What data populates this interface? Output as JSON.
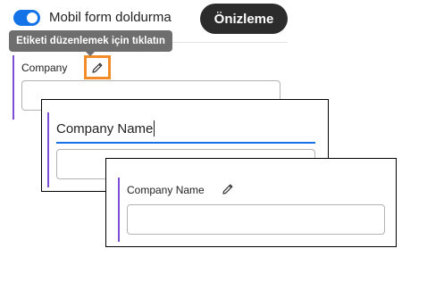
{
  "toolbar": {
    "mobile_form_fill_label": "Mobil form doldurma",
    "mobile_form_fill_enabled": true,
    "preview_label": "Önizleme"
  },
  "tooltip": {
    "text": "Etiketi düzenlemek için tıklatın"
  },
  "field": {
    "label": "Company",
    "edit_icon": "pencil-icon"
  },
  "zoom_editing": {
    "label_value": "Company Name"
  },
  "zoom_result": {
    "label": "Company Name",
    "edit_icon": "pencil-icon"
  },
  "colors": {
    "toggle_on": "#1473e6",
    "preview_button_bg": "#2c2c2c",
    "tooltip_bg": "#6e6e6e",
    "field_accent": "#7b4fd6",
    "highlight_border": "#f28c28",
    "focus_underline": "#1473e6"
  }
}
